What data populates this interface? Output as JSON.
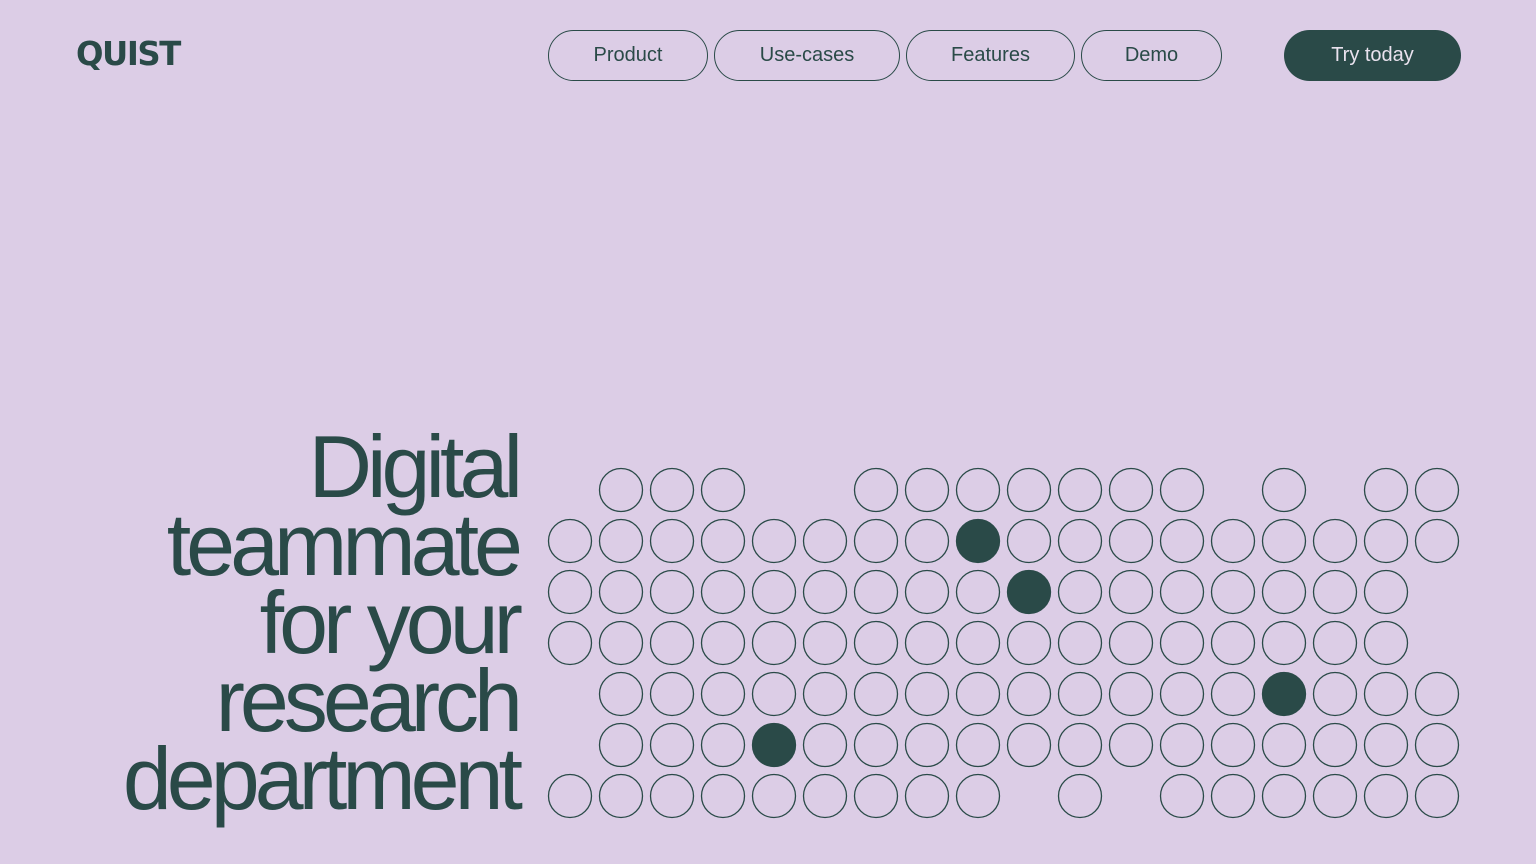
{
  "brand": {
    "logo_text": "QUIST"
  },
  "nav": {
    "items": [
      {
        "label": "Product"
      },
      {
        "label": "Use-cases"
      },
      {
        "label": "Features"
      },
      {
        "label": "Demo"
      }
    ],
    "cta_label": "Try today"
  },
  "hero": {
    "headline_lines": [
      "Digital",
      "teammate",
      "for your",
      "research",
      "department"
    ]
  },
  "dot_grid": {
    "stroke_color": "#2a4a48",
    "fill_color": "#2a4a48",
    "rows": [
      [
        0,
        1,
        1,
        1,
        0,
        0,
        1,
        1,
        1,
        1,
        1,
        1,
        1,
        0,
        1,
        0,
        1,
        1
      ],
      [
        1,
        1,
        1,
        1,
        1,
        1,
        1,
        1,
        2,
        1,
        1,
        1,
        1,
        1,
        1,
        1,
        1,
        1
      ],
      [
        1,
        1,
        1,
        1,
        1,
        1,
        1,
        1,
        1,
        2,
        1,
        1,
        1,
        1,
        1,
        1,
        1,
        0
      ],
      [
        1,
        1,
        1,
        1,
        1,
        1,
        1,
        1,
        1,
        1,
        1,
        1,
        1,
        1,
        1,
        1,
        1,
        0
      ],
      [
        0,
        1,
        1,
        1,
        1,
        1,
        1,
        1,
        1,
        1,
        1,
        1,
        1,
        1,
        2,
        1,
        1,
        1
      ],
      [
        0,
        1,
        1,
        1,
        2,
        1,
        1,
        1,
        1,
        1,
        1,
        1,
        1,
        1,
        1,
        1,
        1,
        1
      ],
      [
        1,
        1,
        1,
        1,
        1,
        1,
        1,
        1,
        1,
        0,
        1,
        0,
        1,
        1,
        1,
        1,
        1,
        1
      ]
    ]
  }
}
